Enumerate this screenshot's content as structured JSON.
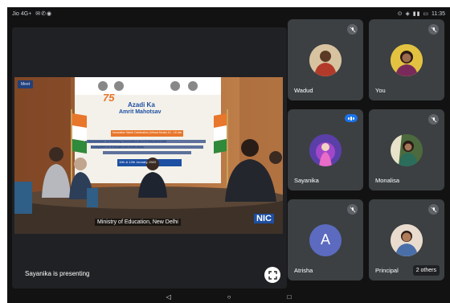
{
  "status_bar": {
    "left_text": "Jio 4G+",
    "right_text": "11:35"
  },
  "presentation": {
    "badge": "Meet",
    "presenter_label": "Sayanika is presenting",
    "slide": {
      "logo_text_1": "75",
      "logo_text_2": "Azadi Ka",
      "logo_text_3": "Amrit Mahotsav",
      "line1": "Innovation Week Celebration (Virtual Mode) 10 - 16 Jan 2022",
      "line2": "e-Symposium on Building Innovation and Entrepreneurial",
      "line3": "Ecosystem in Educational Institutions",
      "line4": "11th & 12th January, 2022"
    },
    "caption": "Ministry of Education, New Delhi",
    "caption_right": "NIC"
  },
  "participants": [
    {
      "name": "Wadud",
      "avatar_type": "photo",
      "muted": true
    },
    {
      "name": "You",
      "avatar_type": "photo",
      "muted": true
    },
    {
      "name": "Sayanika",
      "avatar_type": "photo",
      "speaking": true
    },
    {
      "name": "Monalisa",
      "avatar_type": "photo",
      "muted": true
    },
    {
      "name": "Atrisha",
      "avatar_type": "letter",
      "letter": "A",
      "muted": true
    },
    {
      "name": "Principal",
      "avatar_type": "photo",
      "muted": true
    }
  ],
  "others_label": "2 others",
  "nav_bar": {
    "back": "◁",
    "home": "○",
    "recents": "□"
  },
  "colors": {
    "screen_bg": "#121212",
    "tile_bg": "#3c4043",
    "speaking_blue": "#1a73e8",
    "avatar_indigo": "#5c6bc0"
  }
}
